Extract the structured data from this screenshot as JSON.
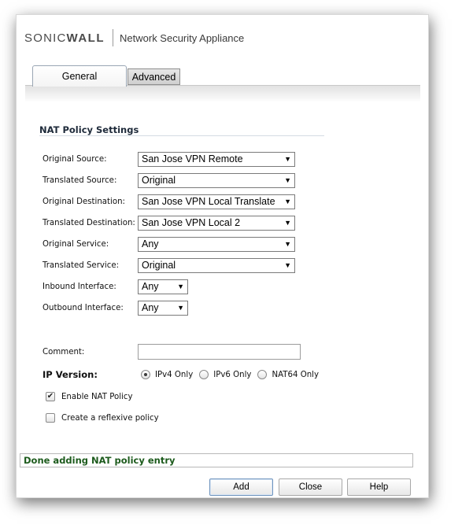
{
  "header": {
    "logo_sonic": "SONIC",
    "logo_wall": "WALL",
    "logo_tm": "·",
    "product": "Network Security Appliance"
  },
  "tabs": [
    {
      "label": "General",
      "active": true
    },
    {
      "label": "Advanced",
      "active": false
    }
  ],
  "section_title": "NAT Policy Settings",
  "fields": {
    "original_source": {
      "label": "Original Source:",
      "value": "San Jose VPN Remote"
    },
    "translated_source": {
      "label": "Translated Source:",
      "value": "Original"
    },
    "original_destination": {
      "label": "Original Destination:",
      "value": "San Jose VPN Local Translate"
    },
    "translated_destination": {
      "label": "Translated Destination:",
      "value": "San Jose VPN Local 2"
    },
    "original_service": {
      "label": "Original Service:",
      "value": "Any"
    },
    "translated_service": {
      "label": "Translated Service:",
      "value": "Original"
    },
    "inbound_interface": {
      "label": "Inbound Interface:",
      "value": "Any"
    },
    "outbound_interface": {
      "label": "Outbound Interface:",
      "value": "Any"
    },
    "comment": {
      "label": "Comment:",
      "value": ""
    }
  },
  "ip_version": {
    "label": "IP Version:",
    "options": [
      {
        "label": "IPv4 Only",
        "selected": true
      },
      {
        "label": "IPv6 Only",
        "selected": false
      },
      {
        "label": "NAT64 Only",
        "selected": false
      }
    ]
  },
  "checkboxes": {
    "enable_nat": {
      "label": "Enable NAT Policy",
      "checked": true
    },
    "reflexive": {
      "label": "Create a reflexive policy",
      "checked": false
    }
  },
  "status": "Done adding NAT policy entry",
  "buttons": {
    "add": "Add",
    "close": "Close",
    "help": "Help"
  },
  "icons": {
    "dropdown_arrow": "▼",
    "check_mark": "✔"
  },
  "colors": {
    "status_text": "#1d5b1d",
    "section_title": "#1e2a3a"
  }
}
